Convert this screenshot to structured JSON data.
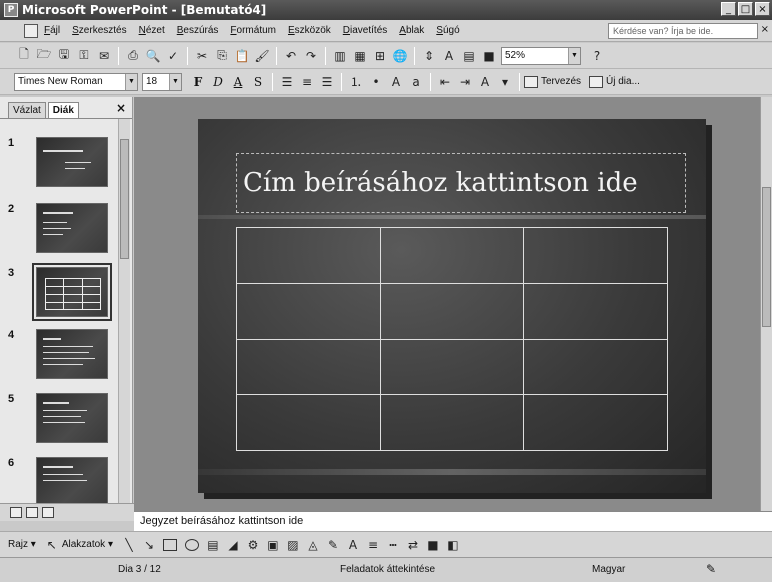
{
  "window": {
    "title": "Microsoft PowerPoint - [Bemutató4]",
    "minimize": "_",
    "restore": "□",
    "close": "×",
    "app_icon": "P"
  },
  "menu": {
    "items": [
      "Fájl",
      "Szerkesztés",
      "Nézet",
      "Beszúrás",
      "Formátum",
      "Eszközök",
      "Diavetítés",
      "Ablak",
      "Súgó"
    ],
    "help_placeholder": "Kérdése van? Írja be ide.",
    "close": "×"
  },
  "standard_toolbar": {
    "zoom": "52%",
    "help_glyph": "?"
  },
  "format_toolbar": {
    "font_name": "Times New Roman",
    "font_size": "18",
    "bold": "F",
    "italic": "D",
    "underline": "A",
    "shadow": "S",
    "design_label": "Tervezés",
    "new_slide_label": "Új dia...",
    "font_color": "A"
  },
  "left_pane": {
    "tabs": [
      "Vázlat",
      "Diák"
    ],
    "close": "×",
    "slides": [
      {
        "num": "1"
      },
      {
        "num": "2"
      },
      {
        "num": "3"
      },
      {
        "num": "4"
      },
      {
        "num": "5"
      },
      {
        "num": "6"
      }
    ],
    "selected_slide": "3"
  },
  "slide": {
    "title": "Cím beírásához kattintson ide",
    "table_rows": 4,
    "table_cols": 3
  },
  "notes": {
    "placeholder": "Jegyzet beírásához kattintson ide"
  },
  "draw_toolbar": {
    "draw_label": "Rajz ▾",
    "autoshapes_label": "Alakzatok ▾"
  },
  "status": {
    "slide_pos": "Dia 3 / 12",
    "design": "Feladatok áttekintése",
    "language": "Magyar"
  },
  "icons": [
    "save-icon",
    "open-icon",
    "print-icon",
    "undo-icon",
    "redo-icon",
    "cut-icon",
    "copy-icon",
    "paste-icon",
    "table-icon",
    "chart-icon",
    "line-icon",
    "rectangle-icon",
    "ellipse-icon",
    "textbox-icon",
    "arrow-icon"
  ]
}
